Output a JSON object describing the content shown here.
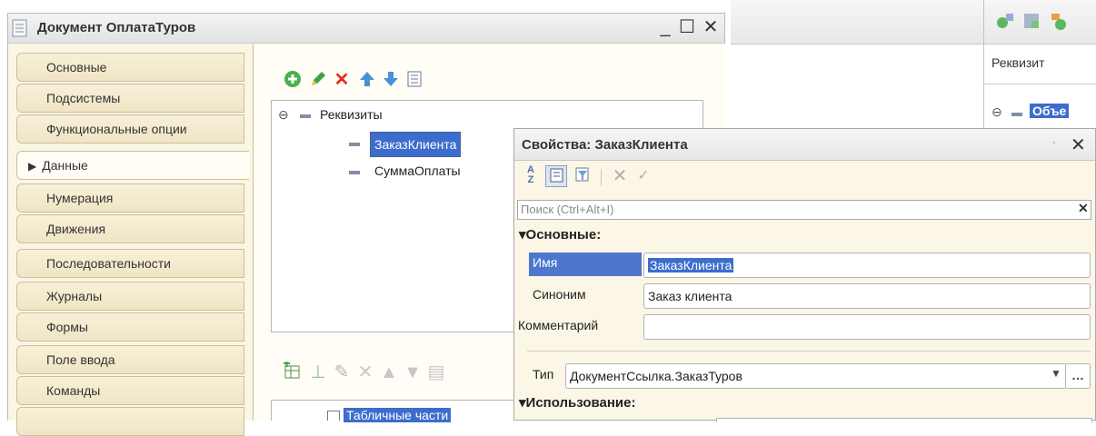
{
  "window": {
    "title": "Документ ОплатаТуров"
  },
  "tabs": [
    {
      "label": "Основные"
    },
    {
      "label": "Подсистемы"
    },
    {
      "label": "Функциональные опции"
    },
    {
      "label": "Данные",
      "active": true
    },
    {
      "label": "Нумерация"
    },
    {
      "label": "Движения"
    },
    {
      "label": "Последовательности"
    },
    {
      "label": "Журналы"
    },
    {
      "label": "Формы"
    },
    {
      "label": "Поле ввода"
    },
    {
      "label": "Команды"
    }
  ],
  "tree": {
    "root": "Реквизиты",
    "items": [
      "ЗаказКлиента",
      "СуммаОплаты"
    ],
    "second_root": "Табличные части"
  },
  "right_panel": {
    "header": "Реквизит",
    "item": "Объе"
  },
  "properties": {
    "title": "Свойства: ЗаказКлиента",
    "search_placeholder": "Поиск (Ctrl+Alt+I)",
    "section_main": "Основные:",
    "name_label": "Имя",
    "name_value": "ЗаказКлиента",
    "synonym_label": "Синоним",
    "synonym_value": "Заказ клиента",
    "comment_label": "Комментарий",
    "comment_value": "",
    "type_label": "Тип",
    "type_value": "ДокументСсылка.ЗаказТуров",
    "section_usage": "Использование:"
  }
}
